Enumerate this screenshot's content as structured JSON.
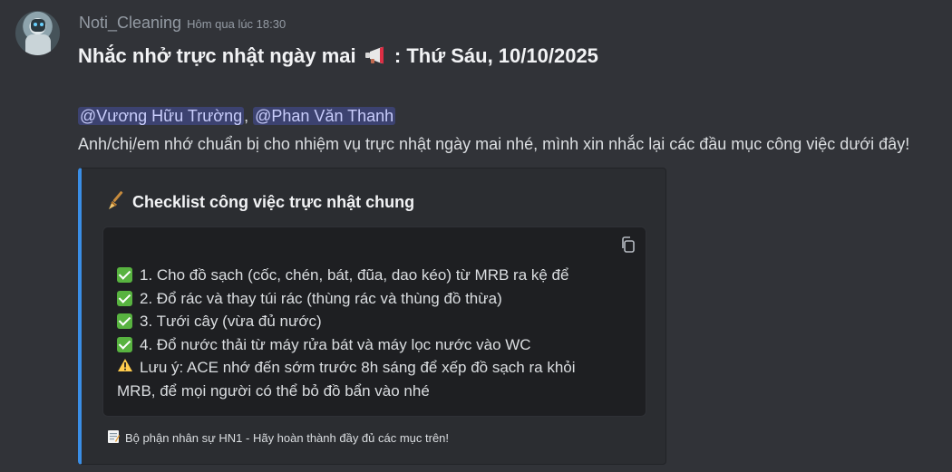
{
  "message": {
    "username": "Noti_Cleaning",
    "timestamp": "Hôm qua lúc 18:30",
    "title_before": "Nhắc nhở trực nhật ngày mai",
    "title_after": ": Thứ Sáu, 10/10/2025",
    "title_icon": "megaphone-icon",
    "mentions": [
      "@Vương Hữu Trường",
      "@Phan Văn Thanh"
    ],
    "mention_separator": ",",
    "intro": "Anh/chị/em nhớ chuẩn bị cho nhiệm vụ trực nhật ngày mai nhé, mình xin nhắc lại các đầu mục công việc dưới đây!"
  },
  "embed": {
    "accent_color": "#3a8ee6",
    "title_icon": "broom-icon",
    "title": "Checklist công việc trực nhật chung",
    "code_block": {
      "copy_icon": "copy-icon",
      "items": [
        "1. Cho đồ sạch (cốc, chén, bát, đũa, dao kéo) từ MRB ra kệ để",
        "2. Đổ rác và thay túi rác (thùng rác và thùng đồ thừa)",
        "3. Tưới cây (vừa đủ nước)",
        "4. Đổ nước thải từ máy rửa bát và máy lọc nước vào WC"
      ],
      "note_icon": "warning-icon",
      "note_line1": "Lưu ý: ACE nhớ đến sớm trước 8h sáng để xếp đồ sạch ra khỏi",
      "note_line2": "MRB, để mọi người có thể bỏ đồ bẩn vào nhé"
    },
    "footer_icon": "memo-icon",
    "footer": "Bộ phận nhân sự HN1 - Hãy hoàn thành đầy đủ các mục trên!"
  }
}
